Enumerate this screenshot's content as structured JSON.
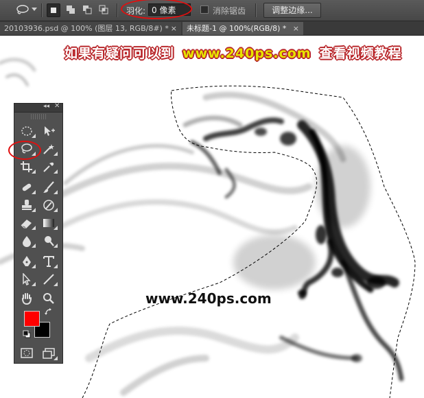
{
  "options_bar": {
    "feather_label": "羽化:",
    "feather_value": "0 像素",
    "anti_alias_label": "消除锯齿",
    "refine_edge_label": "调整边缘..."
  },
  "tabs": [
    {
      "label": "20103936.psd @ 100% (图层 13, RGB/8#) *",
      "close": "×"
    },
    {
      "label": "未标题-1 @ 100%(RGB/8) *",
      "close": "×"
    }
  ],
  "canvas": {
    "promo_left": "如果有疑问可以到",
    "promo_url": "www.240ps.com",
    "promo_right": "查看视频教程",
    "watermark": "www.240ps.com"
  },
  "tool_panel": {
    "collapse_label": "◂◂",
    "close_label": "✕",
    "colors": {
      "foreground": "#ff0000",
      "background": "#000000"
    }
  },
  "icons": [
    "lasso-icon",
    "marquee-icon",
    "move-icon",
    "magic-wand-icon",
    "crop-icon",
    "eyedropper-icon",
    "healing-icon",
    "brush-icon",
    "clone-stamp-icon",
    "history-brush-icon",
    "eraser-icon",
    "gradient-icon",
    "blur-icon",
    "dodge-icon",
    "pen-icon",
    "type-icon",
    "path-select-icon",
    "line-icon",
    "hand-icon",
    "zoom-icon",
    "quick-mask-icon",
    "screen-mode-icon"
  ]
}
